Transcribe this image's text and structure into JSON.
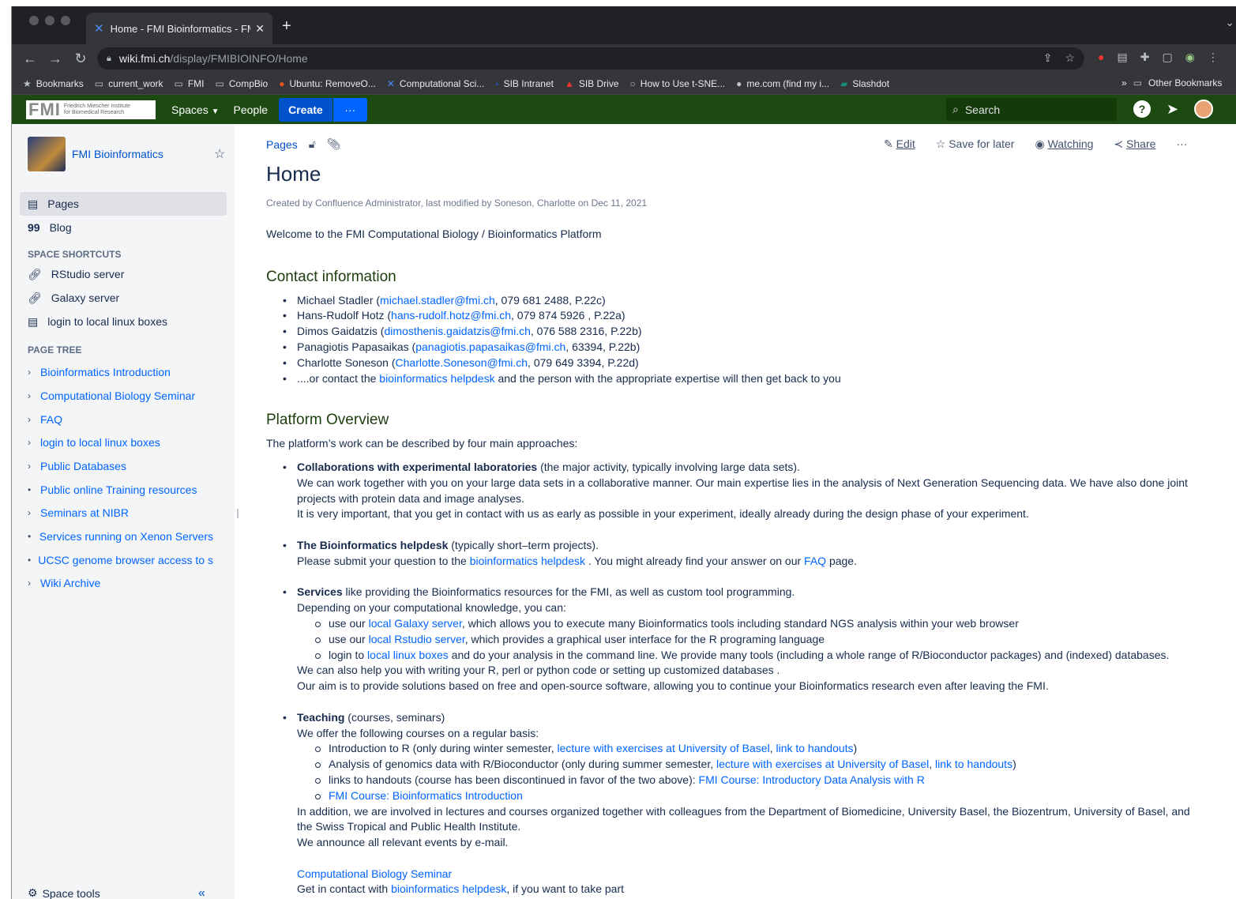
{
  "browser": {
    "tab_title": "Home - FMI Bioinformatics - FMI",
    "url_host": "wiki.fmi.ch",
    "url_path": "/display/FMIBIOINFO/Home",
    "bookmarks": [
      "Bookmarks",
      "current_work",
      "FMI",
      "CompBio",
      "Ubuntu: RemoveO...",
      "Computational Sci...",
      "SIB Intranet",
      "SIB Drive",
      "How to Use t-SNE...",
      "me.com (find my i...",
      "Slashdot"
    ],
    "other_bookmarks": "Other Bookmarks"
  },
  "header": {
    "logo_text": "FMI",
    "logo_sub1": "Friedrich Miescher Institute",
    "logo_sub2": "for Biomedical Research",
    "spaces": "Spaces",
    "people": "People",
    "create": "Create",
    "search_placeholder": "Search"
  },
  "sidebar": {
    "space_name": "FMI Bioinformatics",
    "pages": "Pages",
    "blog": "Blog",
    "shortcuts_heading": "SPACE SHORTCUTS",
    "shortcuts": [
      "RStudio server",
      "Galaxy server",
      "login to local linux boxes"
    ],
    "tree_heading": "PAGE TREE",
    "tree": [
      {
        "label": "Bioinformatics Introduction",
        "marker": "›"
      },
      {
        "label": "Computational Biology Seminar",
        "marker": "›"
      },
      {
        "label": "FAQ",
        "marker": "›"
      },
      {
        "label": "login to local linux boxes",
        "marker": "›"
      },
      {
        "label": "Public Databases",
        "marker": "›"
      },
      {
        "label": "Public online Training resources",
        "marker": "•"
      },
      {
        "label": "Seminars at NIBR",
        "marker": "›"
      },
      {
        "label": "Services running on Xenon Servers",
        "marker": "•"
      },
      {
        "label": "UCSC genome browser access to s",
        "marker": "•"
      },
      {
        "label": "Wiki Archive",
        "marker": "›"
      }
    ],
    "space_tools": "Space tools"
  },
  "page": {
    "breadcrumb": "Pages",
    "actions": {
      "edit": "Edit",
      "save": "Save for later",
      "watching": "Watching",
      "share": "Share"
    },
    "title": "Home",
    "meta": "Created by Confluence Administrator, last modified by Soneson, Charlotte on Dec 11, 2021",
    "welcome": "Welcome to the FMI Computational Biology / Bioinformatics Platform",
    "contact_heading": "Contact information",
    "contacts": [
      {
        "name": "Michael Stadler (",
        "email": "michael.stadler@fmi.ch",
        "rest": ", 079 681 2488, P.22c)"
      },
      {
        "name": "Hans-Rudolf Hotz (",
        "email": "hans-rudolf.hotz@fmi.ch",
        "rest": ", 079 874 5926 , P.22a)"
      },
      {
        "name": "Dimos Gaidatzis (",
        "email": "dimosthenis.gaidatzis@fmi.ch",
        "rest": ", 076 588 2316, P.22b)"
      },
      {
        "name": "Panagiotis Papasaikas (",
        "email": "panagiotis.papasaikas@fmi.ch",
        "rest": ", 63394, P.22b)"
      },
      {
        "name": "Charlotte Soneson (",
        "email": "Charlotte.Soneson@fmi.ch",
        "rest": ", 079 649 3394, P.22d)"
      }
    ],
    "contact_or_pre": "....or contact the ",
    "contact_or_link": "bioinformatics helpdesk",
    "contact_or_post": " and the person with the appropriate expertise will then get back to you",
    "overview_heading": "Platform Overview",
    "overview_intro": "The platform’s work can be described by four main approaches:",
    "collab_title": "Collaborations with experimental laboratories",
    "collab_sub": " (the major activity, typically involving large data sets).",
    "collab_p1": " We can work together with you on your large data sets in a collaborative manner. Our main expertise lies in the analysis of Next Generation Sequencing data. We have also done joint projects with protein data and image analyses.",
    "collab_p2": " It is very important, that you get in contact with us as early as possible in your experiment, ideally already during the design phase of your experiment.",
    "help_title": "The Bioinformatics helpdesk",
    "help_sub": " (typically short–term projects).",
    "help_pre": " Please submit your question to the ",
    "help_link": "bioinformatics helpdesk",
    "help_mid": " . You might already find your answer on our ",
    "help_faq": "FAQ",
    "help_post": " page.",
    "serv_title": "Services",
    "serv_sub": " like providing the Bioinformatics resources for the FMI, as well as custom tool programming.",
    "serv_p1": "Depending on your computational knowledge, you can:",
    "serv_items": [
      {
        "pre": "use our ",
        "link": "local Galaxy server",
        "post": ", which allows you to execute many Bioinformatics tools including standard NGS analysis within your web browser"
      },
      {
        "pre": "use our ",
        "link": "local Rstudio server",
        "post": ", which provides a graphical user interface for the R programing language"
      },
      {
        "pre": "login to ",
        "link": "local linux boxes",
        "post": " and do your analysis in the command line. We provide many tools (including a whole range of R/Bioconductor packages) and (indexed) databases."
      }
    ],
    "serv_p2": "We can also help you with writing your R, perl or python code or setting up customized databases .",
    "serv_p3": "Our aim is to provide solutions based on free and open-source software, allowing you to continue your Bioinformatics research even after leaving the FMI.",
    "teach_title": "Teaching",
    "teach_sub": " (courses, seminars)",
    "teach_p1": " We offer the following courses on a regular basis:",
    "teach_items": [
      {
        "pre": "Introduction to R (only during winter semester, ",
        "l1": "lecture with exercises at University of Basel",
        "mid": ", ",
        "l2": "link to handouts",
        "post": ")"
      },
      {
        "pre": "Analysis of genomics data with R/Bioconductor (only during summer semester, ",
        "l1": "lecture with exercises at University of Basel",
        "mid": ", ",
        "l2": "link to handouts",
        "post": ")"
      }
    ],
    "teach_item3_pre": "links to handouts (course has been discontinued in favor of the two above): ",
    "teach_item3_link": "FMI Course: Introductory Data Analysis with R",
    "teach_item4_link": "FMI Course: Bioinformatics Introduction",
    "teach_p2": "In addition, we are involved in lectures and courses organized together with colleagues from the Department of Biomedicine, University Basel, the Biozentrum, University of Basel, and the Swiss Tropical and Public Health Institute.",
    "teach_p3": "We announce all relevant events by e-mail.",
    "seminar_link": "Computational Biology Seminar",
    "seminar_pre": "Get in contact with ",
    "seminar_helpdesk": "bioinformatics helpdesk",
    "seminar_post": ", if you want to take part"
  }
}
